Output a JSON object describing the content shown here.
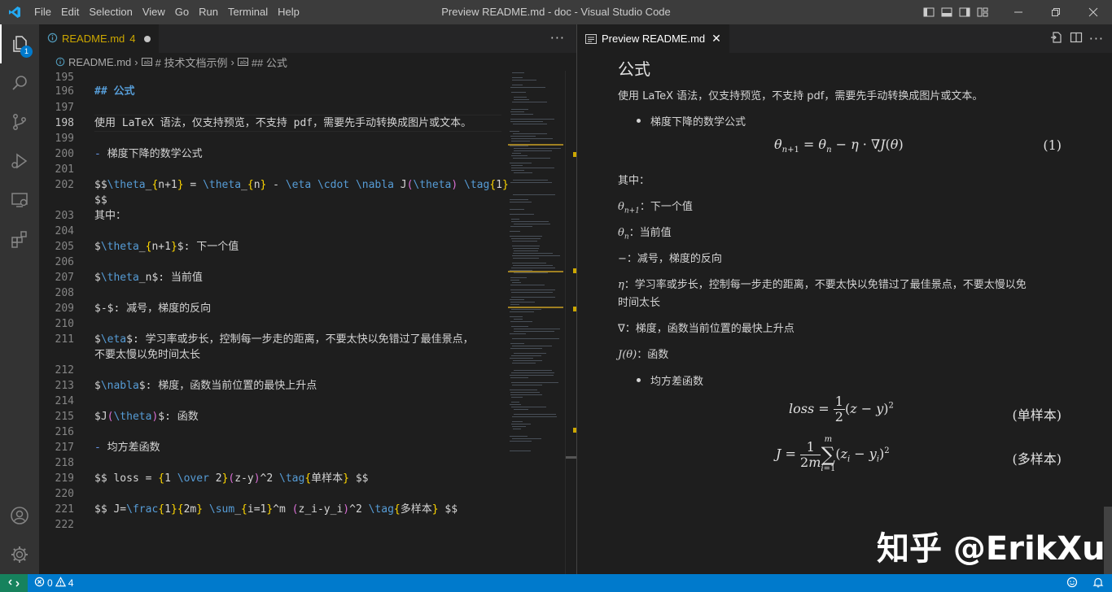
{
  "titlebar": {
    "menu": [
      "File",
      "Edit",
      "Selection",
      "View",
      "Go",
      "Run",
      "Terminal",
      "Help"
    ],
    "window_title": "Preview README.md - doc - Visual Studio Code"
  },
  "activitybar": {
    "items": [
      "explorer-icon",
      "search-icon",
      "source-control-icon",
      "run-debug-icon",
      "remote-explorer-icon",
      "extensions-icon"
    ],
    "explorer_badge": "1",
    "bottom": [
      "accounts-icon",
      "manage-gear-icon"
    ]
  },
  "editor": {
    "tab": {
      "label": "README.md",
      "problems": "4"
    },
    "tab_actions": "···",
    "breadcrumb": [
      "README.md",
      "# 技术文档示例",
      "## 公式"
    ],
    "lines": [
      {
        "n": "195",
        "text": ""
      },
      {
        "n": "196",
        "text": "## 公式",
        "type": "head"
      },
      {
        "n": "197",
        "text": ""
      },
      {
        "n": "198",
        "text": "使用 LaTeX 语法，仅支持预览，不支持 pdf，需要先手动转换成图片或文本。",
        "current": true
      },
      {
        "n": "199",
        "text": ""
      },
      {
        "n": "200",
        "text": "- 梯度下降的数学公式",
        "type": "list"
      },
      {
        "n": "201",
        "text": ""
      },
      {
        "n": "202",
        "text": "$$\\theta_{n+1} = \\theta_{n} - \\eta \\cdot \\nabla J(\\theta) \\tag{1}",
        "type": "math"
      },
      {
        "n": "",
        "text": "$$"
      },
      {
        "n": "203",
        "text": "其中："
      },
      {
        "n": "204",
        "text": ""
      },
      {
        "n": "205",
        "text": "$\\theta_{n+1}$: 下一个值",
        "type": "math"
      },
      {
        "n": "206",
        "text": ""
      },
      {
        "n": "207",
        "text": "$\\theta_n$: 当前值",
        "type": "math"
      },
      {
        "n": "208",
        "text": ""
      },
      {
        "n": "209",
        "text": "$-$: 减号，梯度的反向"
      },
      {
        "n": "210",
        "text": ""
      },
      {
        "n": "211",
        "text": "$\\eta$: 学习率或步长，控制每一步走的距离，不要太快以免错过了最佳景点，",
        "type": "math"
      },
      {
        "n": "",
        "text": "不要太慢以免时间太长"
      },
      {
        "n": "212",
        "text": ""
      },
      {
        "n": "213",
        "text": "$\\nabla$: 梯度，函数当前位置的最快上升点",
        "type": "math"
      },
      {
        "n": "214",
        "text": ""
      },
      {
        "n": "215",
        "text": "$J(\\theta)$: 函数",
        "type": "math"
      },
      {
        "n": "216",
        "text": ""
      },
      {
        "n": "217",
        "text": "- 均方差函数",
        "type": "list"
      },
      {
        "n": "218",
        "text": ""
      },
      {
        "n": "219",
        "text": "$$ loss = {1 \\over 2}(z-y)^2 \\tag{单样本} $$",
        "type": "math"
      },
      {
        "n": "220",
        "text": ""
      },
      {
        "n": "221",
        "text": "$$ J=\\frac{1}{2m} \\sum_{i=1}^m (z_i-y_i)^2 \\tag{多样本} $$",
        "type": "math"
      },
      {
        "n": "222",
        "text": ""
      }
    ]
  },
  "preview": {
    "tab": {
      "label": "Preview README.md"
    },
    "heading": "公式",
    "intro": "使用 LaTeX 语法，仅支持预览，不支持 pdf，需要先手动转换成图片或文本。",
    "bullet1": "梯度下降的数学公式",
    "eq1_tag": "(1)",
    "where": "其中：",
    "defs": [
      {
        "sym": "θ",
        "sub": "n+1",
        "text": "：下一个值"
      },
      {
        "sym": "θ",
        "sub": "n",
        "text": "：当前值"
      },
      {
        "sym": "−",
        "sub": "",
        "text": "：减号，梯度的反向"
      },
      {
        "sym": "η",
        "sub": "",
        "text": "：学习率或步长，控制每一步走的距离，不要太快以免错过了最佳景点，不要太慢以免"
      },
      {
        "sym": "",
        "sub": "",
        "text": "时间太长"
      },
      {
        "sym": "∇",
        "sub": "",
        "text": "：梯度，函数当前位置的最快上升点"
      },
      {
        "sym": "J(θ)",
        "sub": "",
        "text": "：函数"
      }
    ],
    "bullet2": "均方差函数",
    "eq2_tag": "(单样本)",
    "eq3_tag": "(多样本)",
    "watermark": "知乎 @ErikXu"
  },
  "statusbar": {
    "errors": "0",
    "warnings": "4"
  },
  "colors": {
    "statusbar": "#007acc",
    "activitybar": "#333333",
    "editor_bg": "#1e1e1e",
    "heading": "#569cd6",
    "warning": "#cca700"
  }
}
